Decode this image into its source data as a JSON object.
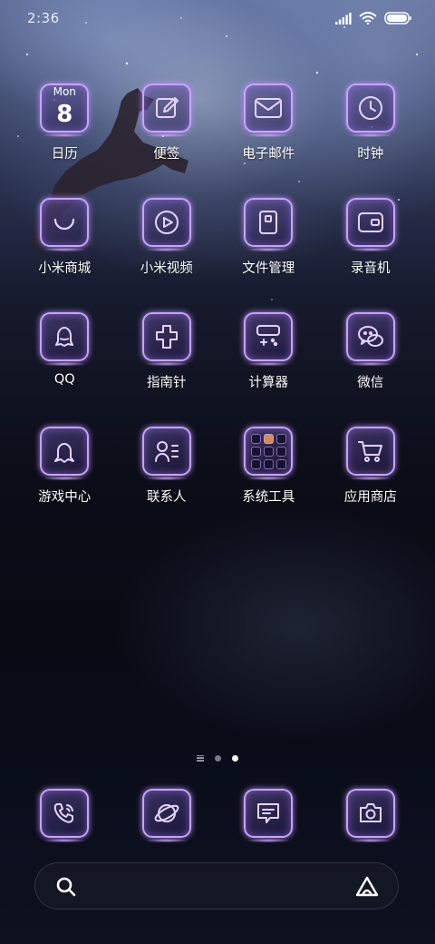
{
  "status_bar": {
    "time": "2:36",
    "icons": [
      "signal-icon",
      "wifi-icon",
      "battery-icon"
    ]
  },
  "theme": {
    "accent": "#c9a7ff",
    "glow": "#a878ff"
  },
  "apps": [
    {
      "label": "日历",
      "icon": "calendar-icon",
      "day": "Mon",
      "date": "8"
    },
    {
      "label": "便签",
      "icon": "notes-icon"
    },
    {
      "label": "电子邮件",
      "icon": "email-icon"
    },
    {
      "label": "时钟",
      "icon": "clock-icon"
    },
    {
      "label": "小米商城",
      "icon": "mi-store-icon"
    },
    {
      "label": "小米视频",
      "icon": "video-icon"
    },
    {
      "label": "文件管理",
      "icon": "file-manager-icon"
    },
    {
      "label": "录音机",
      "icon": "recorder-icon"
    },
    {
      "label": "QQ",
      "icon": "qq-icon"
    },
    {
      "label": "指南针",
      "icon": "compass-icon"
    },
    {
      "label": "计算器",
      "icon": "calculator-icon"
    },
    {
      "label": "微信",
      "icon": "wechat-icon"
    },
    {
      "label": "游戏中心",
      "icon": "game-center-icon"
    },
    {
      "label": "联系人",
      "icon": "contacts-icon"
    },
    {
      "label": "系统工具",
      "icon": "folder-icon"
    },
    {
      "label": "应用商店",
      "icon": "app-store-icon"
    }
  ],
  "page_indicator": {
    "pages": 2,
    "active_page": 2
  },
  "dock": [
    {
      "icon": "phone-icon"
    },
    {
      "icon": "browser-icon"
    },
    {
      "icon": "messages-icon"
    },
    {
      "icon": "camera-icon"
    }
  ],
  "search_bar": {
    "left_icon": "search-icon",
    "right_icon": "assistant-icon"
  }
}
